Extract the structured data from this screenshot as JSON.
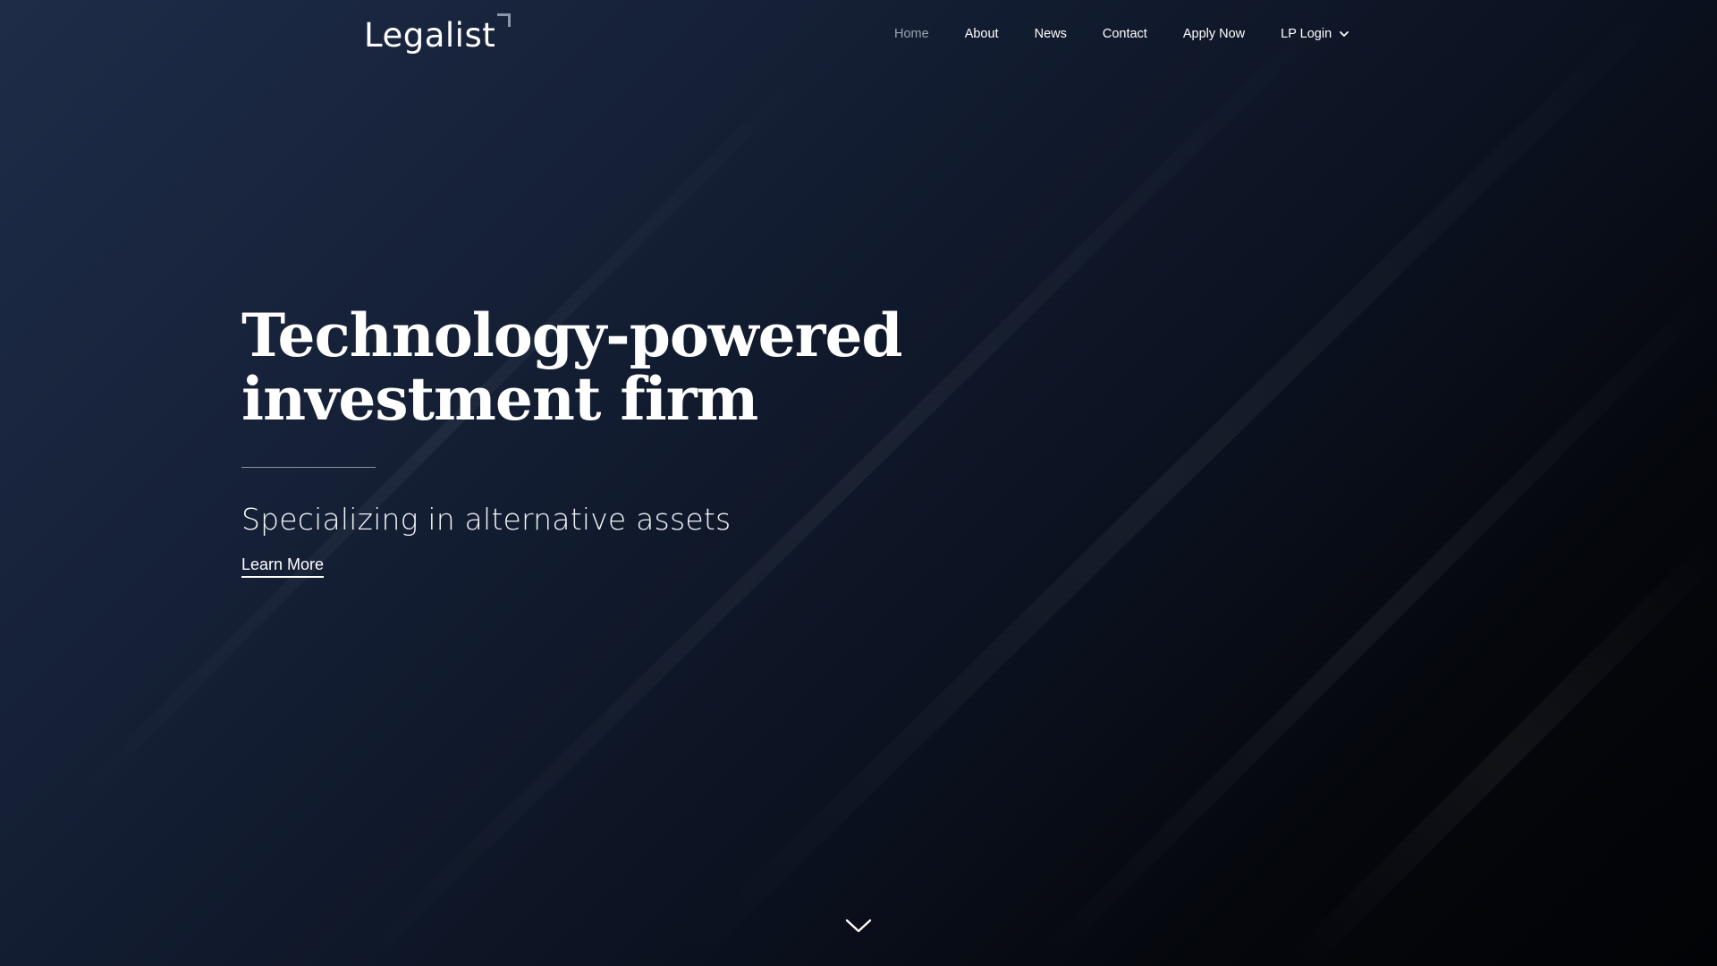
{
  "header": {
    "logo_text": "Legalist"
  },
  "nav": {
    "items": [
      {
        "label": "Home",
        "active": true
      },
      {
        "label": "About"
      },
      {
        "label": "News"
      },
      {
        "label": "Contact"
      },
      {
        "label": "Apply Now"
      },
      {
        "label": "LP Login",
        "has_dropdown": true
      }
    ]
  },
  "hero": {
    "title_line1": "Technology-powered",
    "title_line2": "investment firm",
    "subtitle": "Specializing in alternative assets",
    "cta_label": "Learn More"
  },
  "icons": {
    "logo_mark": "corner-bracket-icon",
    "dropdown": "chevron-down-icon",
    "scroll": "scroll-down-chevron-icon"
  },
  "colors": {
    "background_top_left": "#1e2c48",
    "background_bottom_right": "#020305",
    "text_primary": "#ffffff",
    "nav_active": "#9aa3b3",
    "divider": "#8a93a3"
  }
}
